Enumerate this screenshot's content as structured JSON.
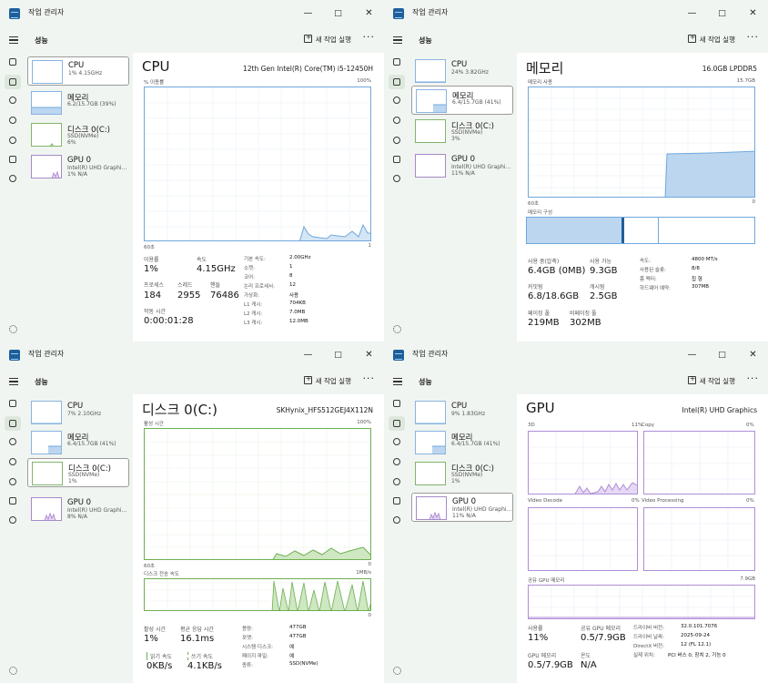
{
  "app_title": "작업 관리자",
  "header": {
    "page_title": "성능",
    "new_task_label": "새 작업 실행",
    "more_label": "···"
  },
  "window_controls": {
    "minimize": "—",
    "maximize": "□",
    "close": "✕"
  },
  "colors": {
    "cpu_blue": "#6fa8dc",
    "mem_fill": "#bcd6f0",
    "gpu_purple": "#b08ed6",
    "disk_green": "#6db050",
    "chrome_bg": "#f1f5f1"
  },
  "nav_icons": [
    "hamburger-icon",
    "processes-icon",
    "performance-icon",
    "app-history-icon",
    "startup-icon",
    "users-icon",
    "details-icon",
    "services-icon",
    "settings-icon"
  ],
  "windows": [
    {
      "sidebar": [
        {
          "name": "CPU",
          "sub1": "1% 4.15GHz",
          "sub2": ""
        },
        {
          "name": "메모리",
          "sub1": "6.2/15.7GB (39%)",
          "sub2": ""
        },
        {
          "name": "디스크 0(C:)",
          "sub1": "SSD(NVMe)",
          "sub2": "6%"
        },
        {
          "name": "GPU 0",
          "sub1": "Intel(R) UHD Graphi...",
          "sub2": "1% N/A"
        }
      ],
      "main": {
        "title": "CPU",
        "model": "12th Gen Intel(R) Core(TM) i5-12450H",
        "graph_label": "% 이용률",
        "graph_max": "100%",
        "axis_left": "60초",
        "axis_right": "1",
        "stats": [
          {
            "label": "이용률",
            "value": "1%"
          },
          {
            "label": "속도",
            "value": "4.15GHz"
          },
          {
            "label": "프로세스",
            "value": "184"
          },
          {
            "label": "스레드",
            "value": "2955"
          },
          {
            "label": "핸들",
            "value": "76486"
          },
          {
            "label": "작동 시간",
            "value": "0:00:01:28"
          }
        ],
        "details": [
          {
            "label": "기본 속도:",
            "value": "2.00GHz"
          },
          {
            "label": "소켓:",
            "value": "1"
          },
          {
            "label": "코어:",
            "value": "8"
          },
          {
            "label": "논리 프로세서:",
            "value": "12"
          },
          {
            "label": "가상화:",
            "value": "사용"
          },
          {
            "label": "L1 캐시:",
            "value": "704KB"
          },
          {
            "label": "L2 캐시:",
            "value": "7.0MB"
          },
          {
            "label": "L3 캐시:",
            "value": "12.0MB"
          }
        ]
      }
    },
    {
      "sidebar": [
        {
          "name": "CPU",
          "sub1": "24% 3.82GHz",
          "sub2": ""
        },
        {
          "name": "메모리",
          "sub1": "6.4/15.7GB (41%)",
          "sub2": ""
        },
        {
          "name": "디스크 0(C:)",
          "sub1": "SSD(NVMe)",
          "sub2": "3%"
        },
        {
          "name": "GPU 0",
          "sub1": "Intel(R) UHD Graphi...",
          "sub2": "11% N/A"
        }
      ],
      "main": {
        "title": "메모리",
        "model": "16.0GB LPDDR5",
        "graph_label": "메모리 사용",
        "graph_max": "15.7GB",
        "axis_left": "60초",
        "axis_right": "0",
        "composition_label": "메모리 구성",
        "stats": [
          {
            "label": "사용 중(압축)",
            "value": "6.4GB (0MB)"
          },
          {
            "label": "사용 가능",
            "value": "9.3GB"
          },
          {
            "label": "커밋됨",
            "value": "6.8/18.6GB"
          },
          {
            "label": "캐시됨",
            "value": "2.5GB"
          },
          {
            "label": "페이징 풀",
            "value": "219MB"
          },
          {
            "label": "비페이징 풀",
            "value": "302MB"
          }
        ],
        "details": [
          {
            "label": "속도:",
            "value": "4800 MT/s"
          },
          {
            "label": "사용된 슬롯:",
            "value": "8/8"
          },
          {
            "label": "폼 팩터:",
            "value": "칩 형"
          },
          {
            "label": "하드웨어 예약:",
            "value": "307MB"
          }
        ]
      }
    },
    {
      "sidebar": [
        {
          "name": "CPU",
          "sub1": "7% 2.10GHz",
          "sub2": ""
        },
        {
          "name": "메모리",
          "sub1": "6.4/15.7GB (41%)",
          "sub2": ""
        },
        {
          "name": "디스크 0(C:)",
          "sub1": "SSD(NVMe)",
          "sub2": "1%"
        },
        {
          "name": "GPU 0",
          "sub1": "Intel(R) UHD Graphi...",
          "sub2": "8% N/A"
        }
      ],
      "main": {
        "title": "디스크 0(C:)",
        "model": "SKHynix_HFS512GEJ4X112N",
        "graph_label": "활성 시간",
        "graph_max": "100%",
        "axis_left": "60초",
        "axis_right": "0",
        "graph2_label": "디스크 전송 속도",
        "graph2_max": "1MB/s",
        "graph2_axis_right": "0",
        "stats": [
          {
            "label": "활성 시간",
            "value": "1%"
          },
          {
            "label": "평균 응답 시간",
            "value": "16.1ms"
          },
          {
            "label": "읽기 속도",
            "value": "0KB/s"
          },
          {
            "label": "쓰기 속도",
            "value": "4.1KB/s"
          }
        ],
        "details": [
          {
            "label": "용량:",
            "value": "477GB"
          },
          {
            "label": "포맷:",
            "value": "477GB"
          },
          {
            "label": "시스템 디스크:",
            "value": "예"
          },
          {
            "label": "페이지 파일:",
            "value": "예"
          },
          {
            "label": "종류:",
            "value": "SSD(NVMe)"
          }
        ]
      }
    },
    {
      "sidebar": [
        {
          "name": "CPU",
          "sub1": "9% 1.83GHz",
          "sub2": ""
        },
        {
          "name": "메모리",
          "sub1": "6.4/15.7GB (41%)",
          "sub2": ""
        },
        {
          "name": "디스크 0(C:)",
          "sub1": "SSD(NVMe)",
          "sub2": "1%"
        },
        {
          "name": "GPU 0",
          "sub1": "Intel(R) UHD Graphi...",
          "sub2": "11% N/A"
        }
      ],
      "main": {
        "title": "GPU",
        "model": "Intel(R) UHD Graphics",
        "engines": [
          {
            "name": "3D",
            "pct": "11%"
          },
          {
            "name": "Copy",
            "pct": "0%"
          },
          {
            "name": "Video Decode",
            "pct": "0%"
          },
          {
            "name": "Video Processing",
            "pct": "0%"
          }
        ],
        "shared_label": "공유 GPU 메모리",
        "shared_max": "7.9GB",
        "stats": [
          {
            "label": "사용률",
            "value": "11%"
          },
          {
            "label": "공유 GPU 메모리",
            "value": "0.5/7.9GB"
          },
          {
            "label": "GPU 메모리",
            "value": "0.5/7.9GB"
          },
          {
            "label": "온도",
            "value": "N/A"
          }
        ],
        "details": [
          {
            "label": "드라이버 버전:",
            "value": "32.0.101.7076"
          },
          {
            "label": "드라이버 날짜:",
            "value": "2025-09-24"
          },
          {
            "label": "DirectX 버전:",
            "value": "12 (FL 12.1)"
          },
          {
            "label": "실제 위치:",
            "value": "PCI 버스 0, 장치 2, 기능 0"
          }
        ]
      }
    }
  ]
}
